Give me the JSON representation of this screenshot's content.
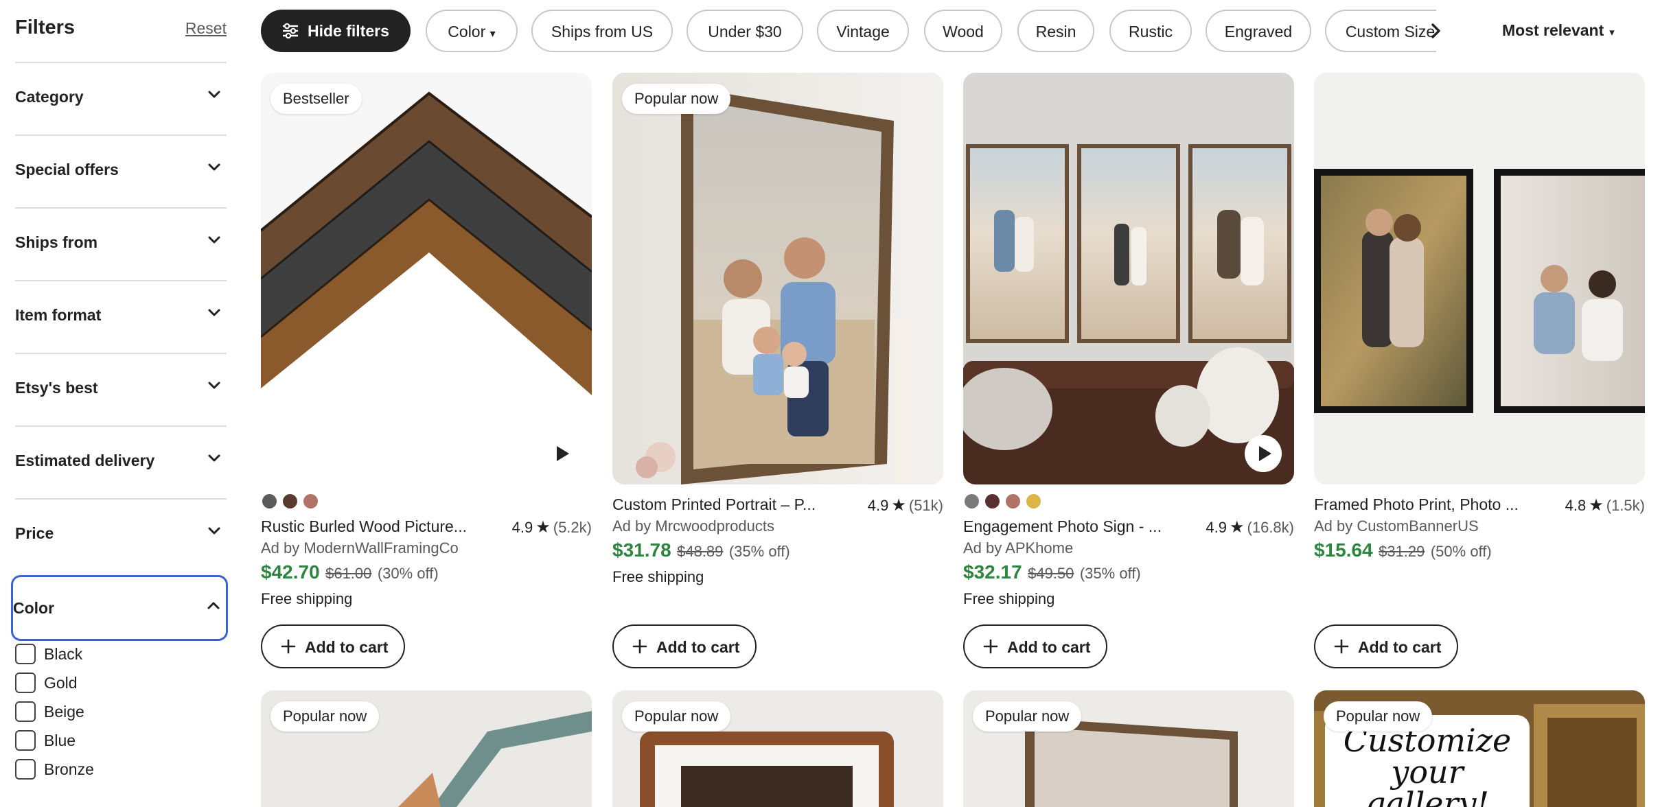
{
  "sidebar": {
    "title": "Filters",
    "reset": "Reset",
    "sections": [
      {
        "label": "Category"
      },
      {
        "label": "Special offers"
      },
      {
        "label": "Ships from"
      },
      {
        "label": "Item format"
      },
      {
        "label": "Etsy's best"
      },
      {
        "label": "Estimated delivery"
      },
      {
        "label": "Price"
      },
      {
        "label": "Color"
      }
    ],
    "color_options": [
      "Black",
      "Gold",
      "Beige",
      "Blue",
      "Bronze"
    ]
  },
  "topbar": {
    "hide_filters": "Hide filters",
    "chips": [
      "Color",
      "Ships from US",
      "Under $30",
      "Vintage",
      "Wood",
      "Resin",
      "Rustic",
      "Engraved",
      "Custom Size"
    ],
    "sort": "Most relevant"
  },
  "cards": [
    {
      "badge": "Bestseller",
      "title": "Rustic Burled Wood Picture...",
      "rating": "4.9",
      "reviews": "(5.2k)",
      "shop": "Ad by ModernWallFramingCo",
      "price": "$42.70",
      "original_price": "$61.00",
      "discount": "(30% off)",
      "shipping": "Free shipping",
      "add_to_cart": "Add to cart",
      "swatch_colors": [
        "#5b5b5b",
        "#5a3a2e",
        "#b07466"
      ]
    },
    {
      "badge": "Popular now",
      "title": "Custom Printed Portrait – P...",
      "rating": "4.9",
      "reviews": "(51k)",
      "shop": "Ad by Mrcwoodproducts",
      "price": "$31.78",
      "original_price": "$48.89",
      "discount": "(35% off)",
      "shipping": "Free shipping",
      "add_to_cart": "Add to cart"
    },
    {
      "title": "Engagement Photo Sign - ...",
      "rating": "4.9",
      "reviews": "(16.8k)",
      "shop": "Ad by APKhome",
      "price": "$32.17",
      "original_price": "$49.50",
      "discount": "(35% off)",
      "shipping": "Free shipping",
      "add_to_cart": "Add to cart",
      "swatch_colors": [
        "#7a7a7a",
        "#5a2f2f",
        "#b07466",
        "#d9b54a"
      ]
    },
    {
      "title": "Framed Photo Print, Photo ...",
      "rating": "4.8",
      "reviews": "(1.5k)",
      "shop": "Ad by CustomBannerUS",
      "price": "$15.64",
      "original_price": "$31.29",
      "discount": "(50% off)",
      "add_to_cart": "Add to cart"
    }
  ],
  "row2_badges": [
    "Popular now",
    "Popular now",
    "Popular now",
    "Popular now"
  ],
  "row2_promo_text": "Customize your gallery!",
  "colors": {
    "accent_dark": "#222222",
    "price_green": "#2e8540",
    "focus_blue": "#3b63d8"
  }
}
